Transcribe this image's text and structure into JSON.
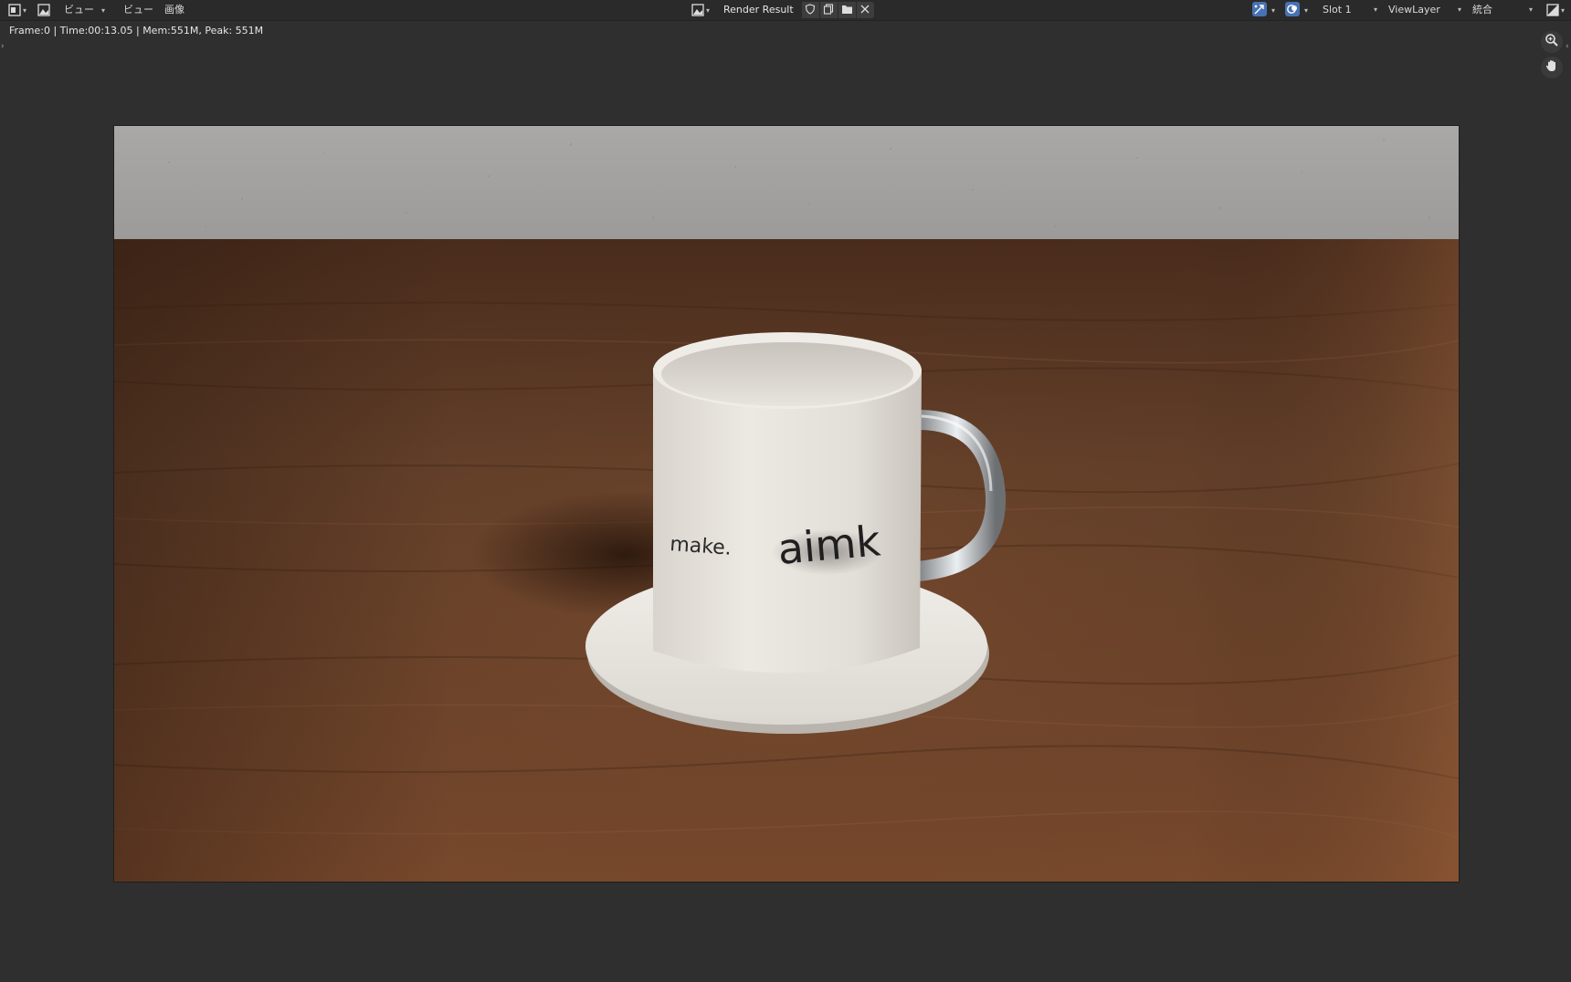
{
  "header": {
    "editor_type_icon": "image-editor-icon",
    "view_icon": "image-icon",
    "menus": [
      {
        "id": "view1",
        "label": "ビュー"
      },
      {
        "id": "view2",
        "label": "ビュー"
      },
      {
        "id": "image",
        "label": "画像"
      }
    ],
    "image_name": "Render Result",
    "image_buttons": [
      "shield-icon",
      "duplicate-icon",
      "folder-icon",
      "close-icon"
    ],
    "slot": "Slot 1",
    "view_layer": "ViewLayer",
    "pass": "統合",
    "gizmo_icon": "gizmo-icon",
    "overlay_icon": "overlay-icon",
    "display_channels_icon": "display-channels-icon"
  },
  "status": {
    "text": "Frame:0 | Time:00:13.05 | Mem:551M, Peak: 551M"
  },
  "navigation": {
    "zoom_icon": "zoom-icon",
    "pan_icon": "hand-icon"
  },
  "render": {
    "mug_text_left": "make.",
    "mug_text_right": "aimk",
    "colors": {
      "wall": "#a7a6a4",
      "table": "#6b3f26",
      "mug": "#e3dfd9",
      "handle": "#bfc1c3"
    }
  }
}
